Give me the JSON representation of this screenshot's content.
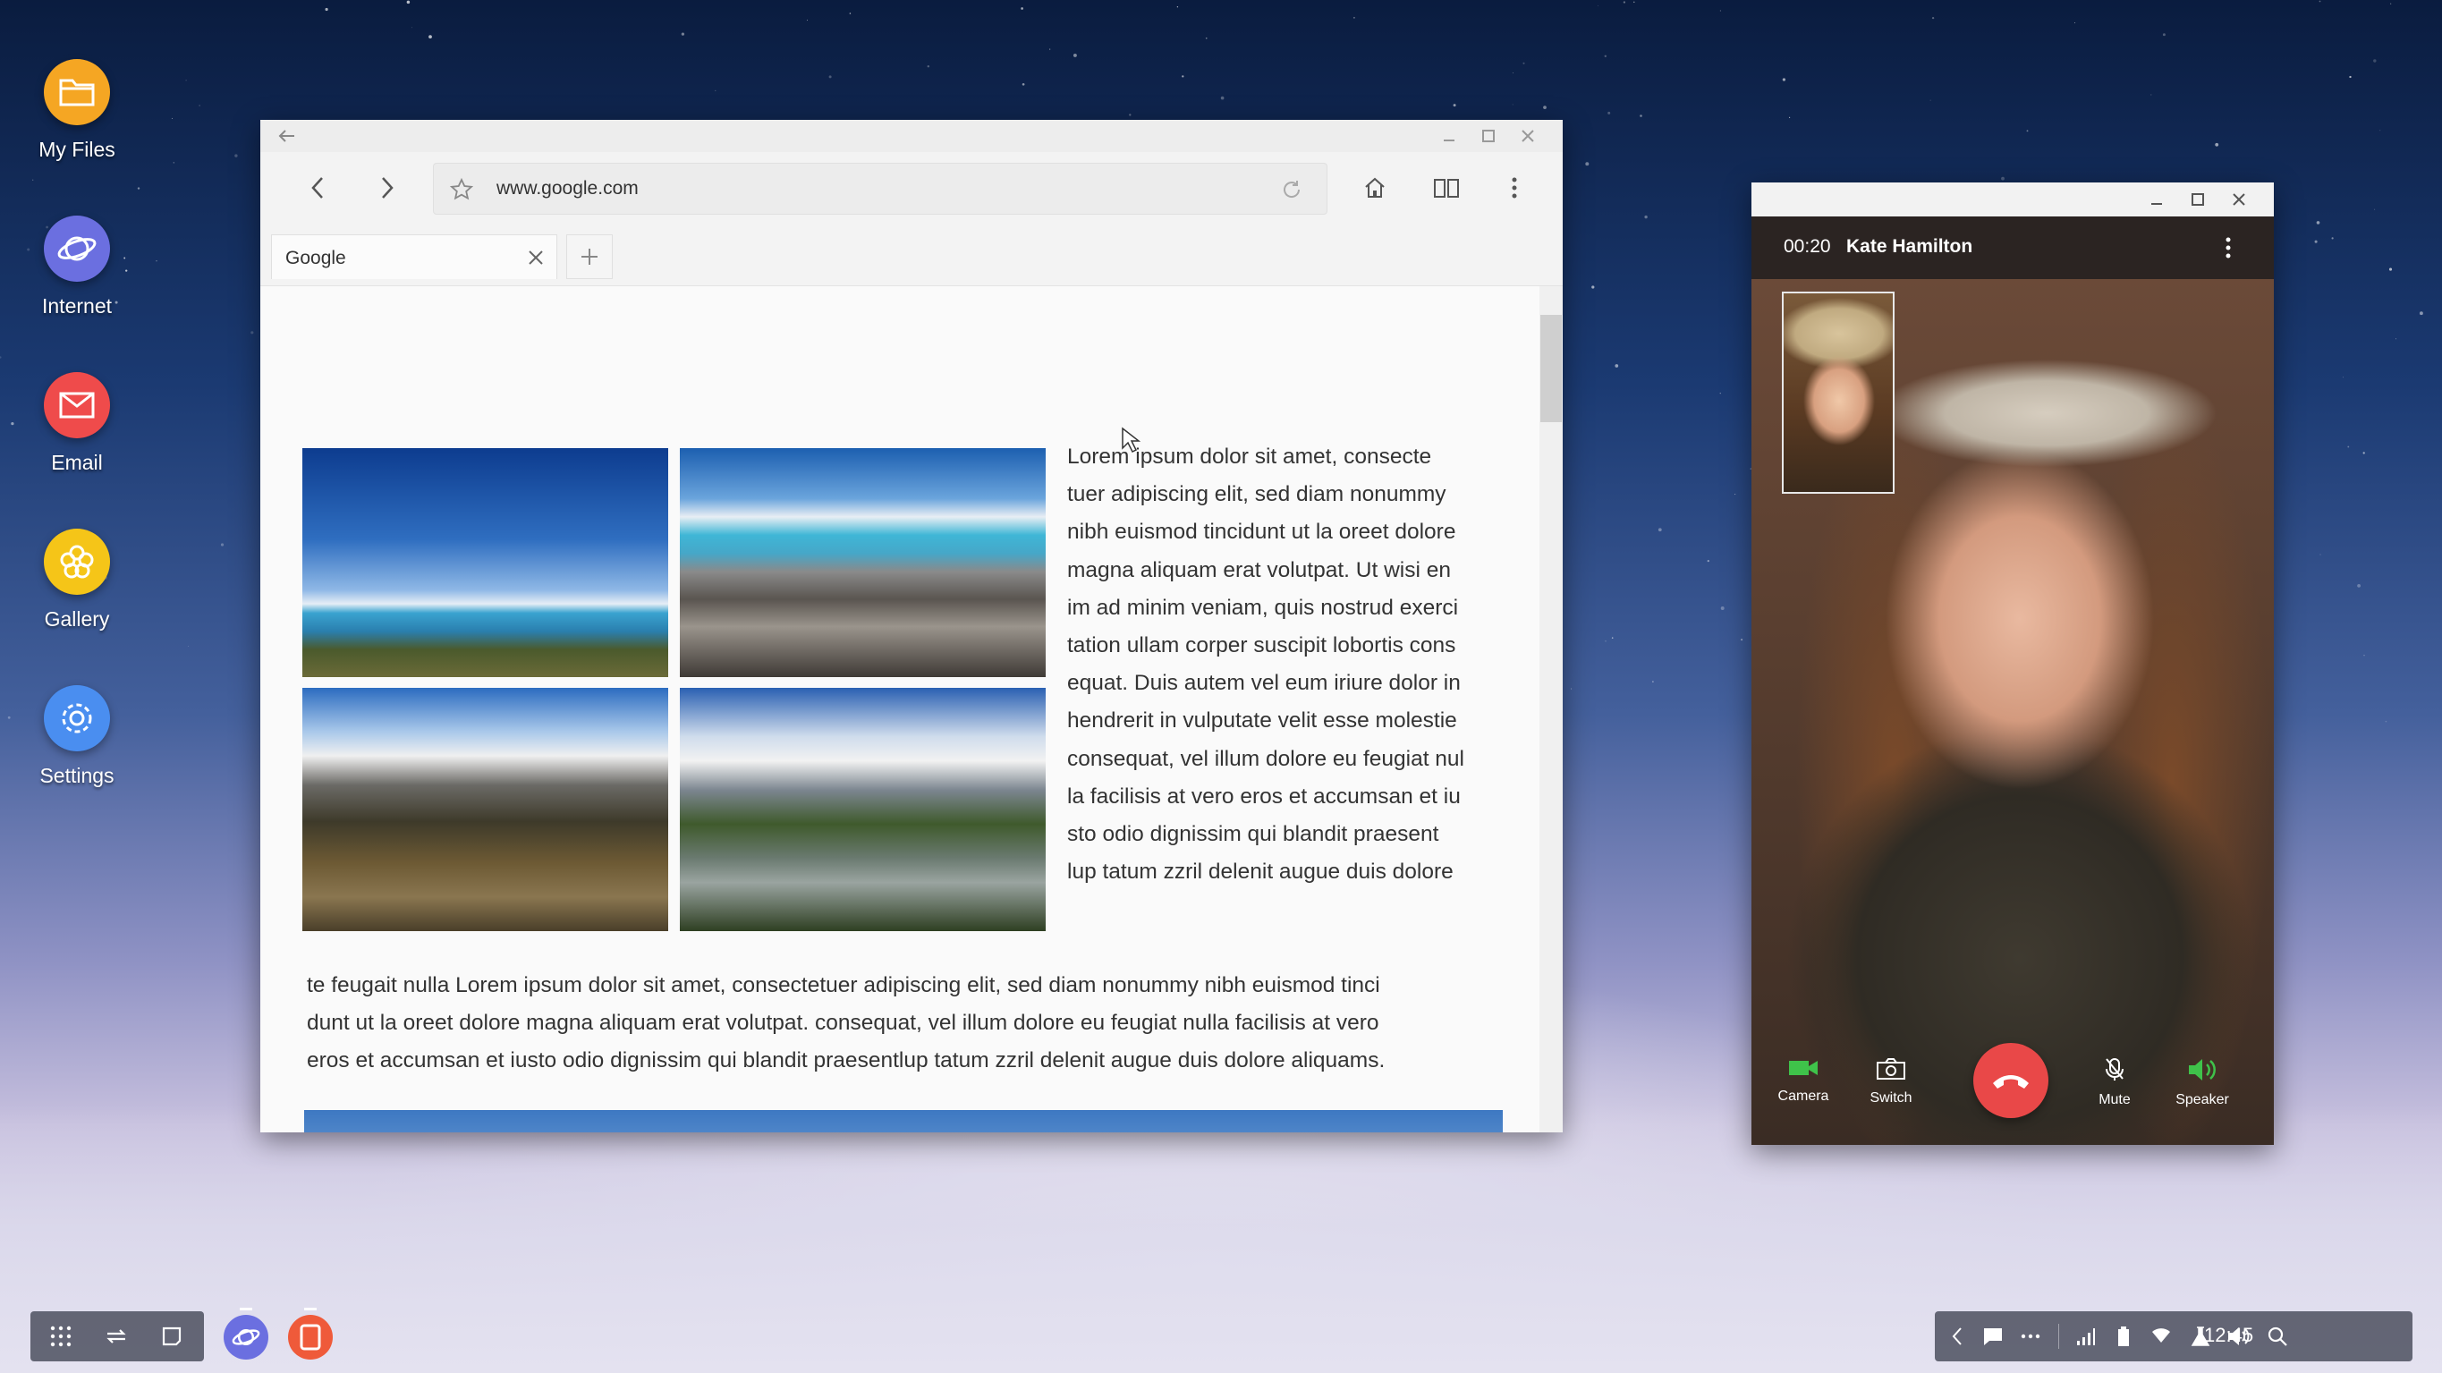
{
  "desktop": {
    "icons": [
      {
        "label": "My Files",
        "icon": "folder-icon",
        "color": "#f5a623"
      },
      {
        "label": "Internet",
        "icon": "planet-icon",
        "color": "#6b6fe0"
      },
      {
        "label": "Email",
        "icon": "envelope-icon",
        "color": "#ef4b4b"
      },
      {
        "label": "Gallery",
        "icon": "flower-icon",
        "color": "#f5c518"
      },
      {
        "label": "Settings",
        "icon": "gear-icon",
        "color": "#4a8ef0"
      }
    ]
  },
  "browser": {
    "url": "www.google.com",
    "tabs": [
      {
        "label": "Google"
      }
    ],
    "side_text": "Lorem ipsum dolor sit amet, consecte tuer adipiscing elit, sed diam nonummy nibh euismod tincidunt ut la oreet dolore magna aliquam erat volutpat. Ut wisi en im ad minim veniam, quis nostrud exerci tation ullam corper suscipit lobortis cons equat. Duis autem vel eum iriure dolor in hendrerit in vulputate velit esse molestie consequat, vel illum dolore eu feugiat nul la facilisis at vero eros et accumsan et iu sto odio dignissim qui blandit praesent lup tatum zzril delenit augue duis dolore",
    "side_lines": [
      "Lorem ipsum dolor sit amet, consecte",
      "tuer adipiscing elit, sed diam nonummy",
      "nibh euismod tincidunt ut la oreet dolore",
      "magna aliquam erat volutpat. Ut wisi en",
      "im ad minim veniam, quis nostrud exerci",
      "tation ullam corper suscipit lobortis cons",
      "equat. Duis autem vel eum iriure dolor in",
      "hendrerit in vulputate velit esse molestie",
      "consequat, vel illum dolore eu feugiat nul",
      "la facilisis at vero eros et accumsan et iu",
      "sto odio dignissim qui blandit praesent",
      "lup tatum zzril delenit augue duis dolore"
    ],
    "body_lines": [
      "te feugait nulla Lorem ipsum dolor sit amet, consectetuer adipiscing elit, sed diam nonummy nibh euismod tinci",
      "dunt ut la oreet dolore magna aliquam erat volutpat. consequat, vel illum dolore eu feugiat nulla facilisis at vero",
      "eros et accumsan et iusto odio dignissim qui blandit praesentlup tatum zzril delenit augue duis dolore aliquams."
    ]
  },
  "call": {
    "timer": "00:20",
    "caller": "Kate Hamilton",
    "controls": [
      {
        "label": "Camera",
        "icon": "video-camera-icon"
      },
      {
        "label": "Switch",
        "icon": "switch-camera-icon"
      },
      {
        "label": "Mute",
        "icon": "microphone-icon"
      },
      {
        "label": "Speaker",
        "icon": "speaker-icon"
      }
    ],
    "end_call_color": "#e94848",
    "accent": "#3fc24a"
  },
  "taskbar": {
    "clock": "12:45"
  }
}
